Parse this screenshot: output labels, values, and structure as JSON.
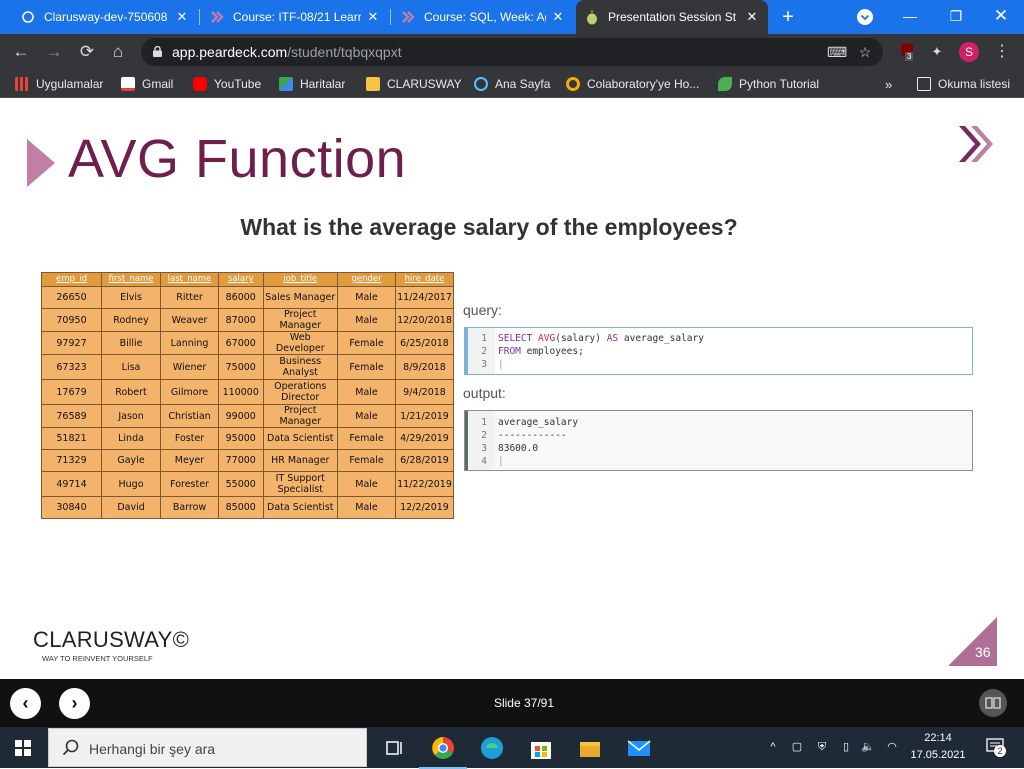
{
  "browser": {
    "tabs": [
      {
        "title": "Clarusway-dev-750608",
        "favicon": "circle-icon"
      },
      {
        "title": "Course: ITF-08/21 Learn",
        "favicon": "chevron-logo-icon"
      },
      {
        "title": "Course: SQL, Week: Agg",
        "favicon": "chevron-logo-icon"
      },
      {
        "title": "Presentation Session St",
        "favicon": "peardeck-icon",
        "active": true
      }
    ],
    "url_host": "app.peardeck.com",
    "url_path": "/student/tqbqxqpxt",
    "extension_badge": "3",
    "profile_initial": "S"
  },
  "bookmarks": [
    {
      "label": "Uygulamalar",
      "icon": "apps-grid-icon",
      "color": "#ea4335"
    },
    {
      "label": "Gmail",
      "icon": "gmail-icon",
      "color": "#ea4335"
    },
    {
      "label": "YouTube",
      "icon": "youtube-icon",
      "color": "#ff0000"
    },
    {
      "label": "Haritalar",
      "icon": "maps-icon",
      "color": "#34a853"
    },
    {
      "label": "CLARUSWAY",
      "icon": "folder-icon",
      "color": "#f6c445"
    },
    {
      "label": "Ana Sayfa",
      "icon": "react-icon",
      "color": "#4dc4ff"
    },
    {
      "label": "Colaboratory'ye Ho...",
      "icon": "colab-icon",
      "color": "#f9ab00"
    },
    {
      "label": "Python Tutorial",
      "icon": "w3-icon",
      "color": "#4caf50"
    }
  ],
  "reading_list": "Okuma listesi",
  "slide": {
    "title": "AVG Function",
    "question": "What is the average salary of the employees?",
    "table": {
      "headers": [
        "emp_id",
        "first_name",
        "last_name",
        "salary",
        "job_title",
        "gender",
        "hire_date"
      ],
      "rows": [
        [
          "26650",
          "Elvis",
          "Ritter",
          "86000",
          "Sales Manager",
          "Male",
          "11/24/2017"
        ],
        [
          "70950",
          "Rodney",
          "Weaver",
          "87000",
          "Project Manager",
          "Male",
          "12/20/2018"
        ],
        [
          "97927",
          "Billie",
          "Lanning",
          "67000",
          "Web Developer",
          "Female",
          "6/25/2018"
        ],
        [
          "67323",
          "Lisa",
          "Wiener",
          "75000",
          "Business Analyst",
          "Female",
          "8/9/2018"
        ],
        [
          "17679",
          "Robert",
          "Gilmore",
          "110000",
          "Operations Director",
          "Male",
          "9/4/2018"
        ],
        [
          "76589",
          "Jason",
          "Christian",
          "99000",
          "Project Manager",
          "Male",
          "1/21/2019"
        ],
        [
          "51821",
          "Linda",
          "Foster",
          "95000",
          "Data Scientist",
          "Female",
          "4/29/2019"
        ],
        [
          "71329",
          "Gayle",
          "Meyer",
          "77000",
          "HR Manager",
          "Female",
          "6/28/2019"
        ],
        [
          "49714",
          "Hugo",
          "Forester",
          "55000",
          "IT Support Specialist",
          "Male",
          "11/22/2019"
        ],
        [
          "30840",
          "David",
          "Barrow",
          "85000",
          "Data Scientist",
          "Male",
          "12/2/2019"
        ]
      ]
    },
    "query_label": "query:",
    "query_lines": [
      {
        "n": "1",
        "select": "SELECT ",
        "fn": "AVG",
        "rest": "(salary) ",
        "as": "AS",
        "alias": " average_salary"
      },
      {
        "n": "2",
        "from": "FROM",
        "rest": " employees;"
      },
      {
        "n": "3"
      }
    ],
    "output_label": "output:",
    "output_lines": [
      {
        "n": "1",
        "text": "average_salary"
      },
      {
        "n": "2",
        "text": "------------"
      },
      {
        "n": "3",
        "text": "83600.0"
      },
      {
        "n": "4",
        "text": ""
      }
    ],
    "logo": "CLARUSWAY©",
    "logo_tagline": "WAY TO REINVENT YOURSELF",
    "page_number": "36",
    "accent": "#6e1f4d",
    "table_color": "#f3b36b"
  },
  "deck": {
    "counter": "Slide 37/91"
  },
  "taskbar": {
    "search_placeholder": "Herhangi bir şey ara",
    "time": "22:14",
    "date": "17.05.2021",
    "notifications": "2"
  }
}
